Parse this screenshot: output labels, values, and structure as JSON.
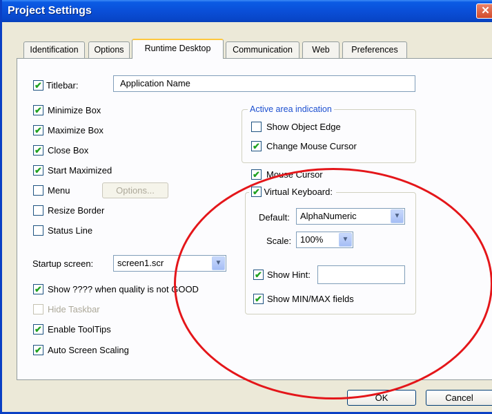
{
  "window": {
    "title": "Project Settings",
    "close_glyph": "✕"
  },
  "tabs": [
    "Identification",
    "Options",
    "Runtime Desktop",
    "Communication",
    "Web",
    "Preferences"
  ],
  "active_tab": "Runtime Desktop",
  "titlebar_option": {
    "label": "Titlebar:",
    "checked": true,
    "value": "Application Name"
  },
  "left_options": [
    {
      "label": "Minimize Box",
      "checked": true
    },
    {
      "label": "Maximize Box",
      "checked": true
    },
    {
      "label": "Close Box",
      "checked": true
    },
    {
      "label": "Start Maximized",
      "checked": true
    },
    {
      "label": "Menu",
      "checked": false
    },
    {
      "label": "Resize Border",
      "checked": false
    },
    {
      "label": "Status Line",
      "checked": false
    }
  ],
  "options_button": "Options...",
  "startup": {
    "label": "Startup screen:",
    "value": "screen1.scr"
  },
  "bottom_options": [
    {
      "label": "Show ???? when quality is not GOOD",
      "checked": true,
      "enabled": true
    },
    {
      "label": "Hide Taskbar",
      "checked": false,
      "enabled": false
    },
    {
      "label": "Enable ToolTips",
      "checked": true,
      "enabled": true
    },
    {
      "label": "Auto Screen Scaling",
      "checked": true,
      "enabled": true
    }
  ],
  "active_area": {
    "legend": "Active area indication",
    "show_object_edge": {
      "label": "Show Object Edge",
      "checked": false
    },
    "change_mouse_cursor": {
      "label": "Change Mouse Cursor",
      "checked": true
    }
  },
  "mouse_cursor": {
    "label": "Mouse Cursor",
    "checked": true
  },
  "virtual_keyboard": {
    "label": "Virtual Keyboard:",
    "checked": true,
    "default_label": "Default:",
    "default_value": "AlphaNumeric",
    "scale_label": "Scale:",
    "scale_value": "100%",
    "show_hint": {
      "label": "Show Hint:",
      "checked": true,
      "value": ""
    },
    "show_minmax": {
      "label": "Show MIN/MAX fields",
      "checked": true
    }
  },
  "footer": {
    "ok": "OK",
    "cancel": "Cancel"
  },
  "glyphs": {
    "check": "✔",
    "dropdown": "▼"
  },
  "colors": {
    "titlebar": "#0a4fd8",
    "active_tab_accent": "#ffc83c",
    "annotation_ellipse": "#e4161a",
    "checkmark": "#21a121",
    "legend_text": "#1c4fd0"
  }
}
